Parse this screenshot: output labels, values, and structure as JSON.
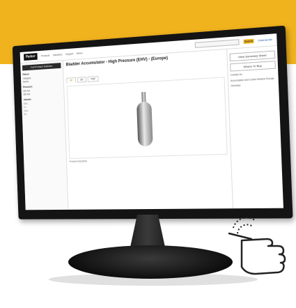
{
  "site": {
    "logo": "Parker",
    "nav": [
      "Products",
      "Industries",
      "Support",
      "About"
    ],
    "search_button": "Search",
    "external_link": "External link"
  },
  "sidebar": {
    "header": "Full Product Selector",
    "sections": [
      {
        "title": "Filters",
        "items": [
          "Category",
          "Series"
        ]
      },
      {
        "title": "Pressure",
        "items": [
          "500 bar",
          "350 bar"
        ]
      },
      {
        "title": "Volume",
        "items": [
          "0.5 L",
          "1 L",
          "2.5 L",
          "5 L"
        ]
      }
    ]
  },
  "main": {
    "title": "Bladder Accumulator - High Pressure (EHV) - (Europe)",
    "tabs": [
      "3D",
      "2D",
      "PDF"
    ],
    "description": "Product Description"
  },
  "right": {
    "summary_button": "View Summary Sheet",
    "buy_button": "Where To Buy",
    "contact_title": "Contact Us",
    "contact_lines": [
      "Accumulator and Cooler Division Europe",
      "Germany"
    ]
  },
  "colors": {
    "accent": "#f0b21d",
    "bezel": "#141414"
  }
}
